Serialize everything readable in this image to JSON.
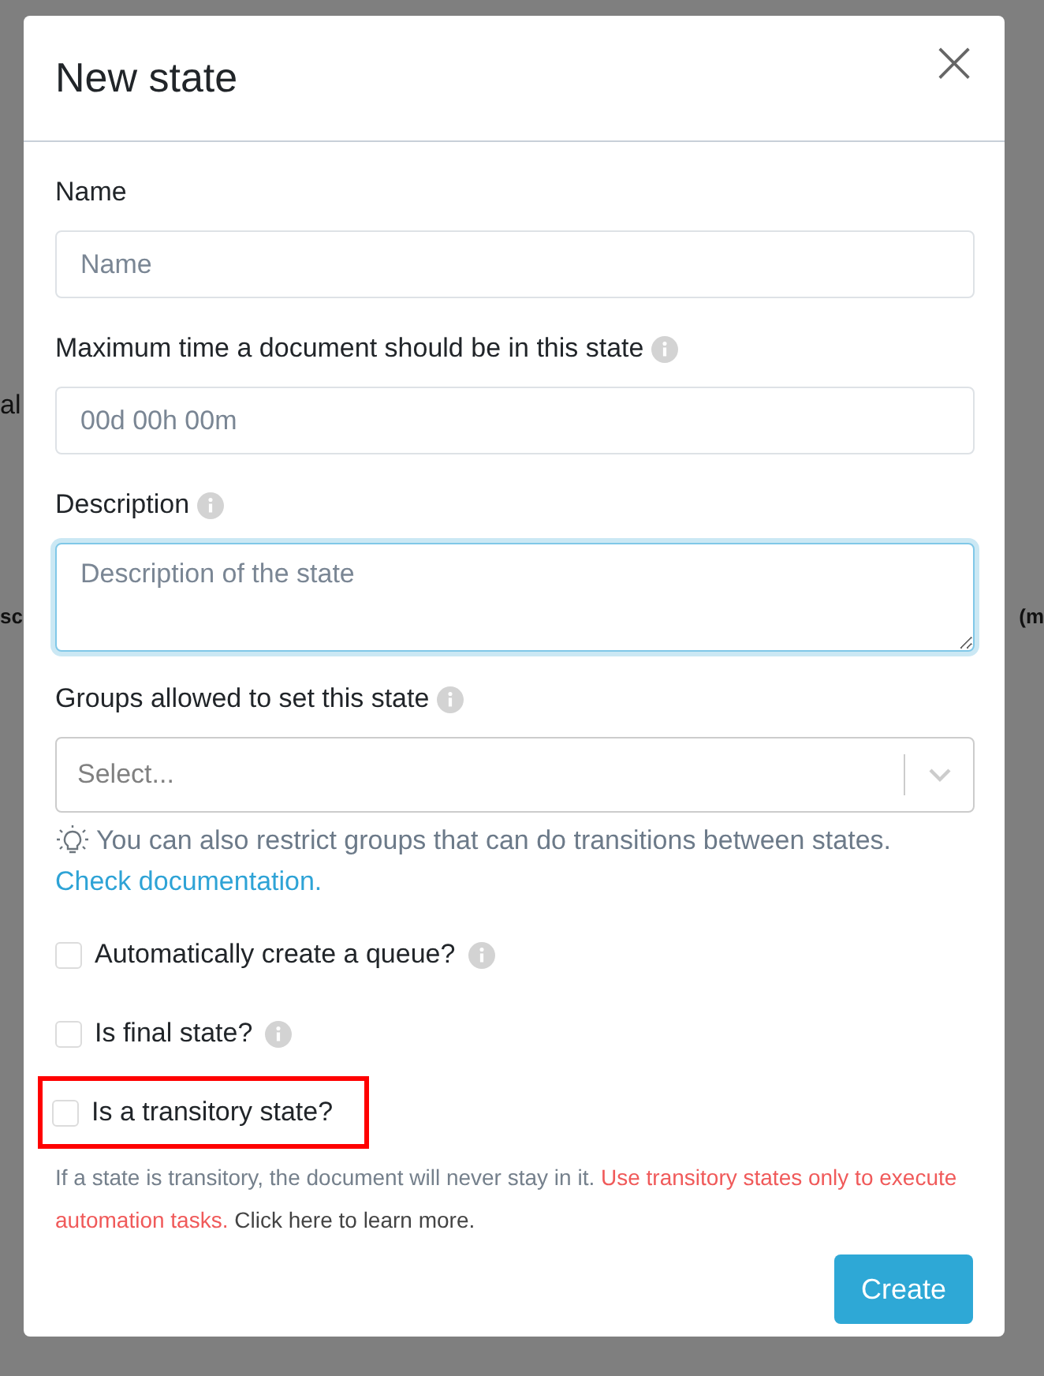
{
  "background": {
    "left_texts": [
      "al",
      "sc"
    ],
    "right_texts": [
      "(m"
    ]
  },
  "dialog": {
    "title": "New state",
    "close": "×",
    "fields": [
      {
        "kind": "input",
        "label": "Name",
        "info": false,
        "placeholder": "Name",
        "focused": false
      },
      {
        "kind": "input",
        "label": "Maximum time a document should be in this state",
        "info": true,
        "placeholder": "00d 00h 00m",
        "focused": false
      },
      {
        "kind": "textarea",
        "label": "Description",
        "info": true,
        "placeholder": "Description of the state",
        "focused": true
      },
      {
        "kind": "select",
        "label": "Groups allowed to set this state",
        "info": true,
        "placeholder": "Select...",
        "focused": false
      }
    ],
    "hint": {
      "text": "You can also restrict groups that can do transitions between states.",
      "link": "Check documentation."
    },
    "checkboxes": [
      {
        "label": "Automatically create a queue?",
        "info": true,
        "checked": false,
        "highlighted": false
      },
      {
        "label": "Is final state?",
        "info": true,
        "checked": false,
        "highlighted": false
      },
      {
        "label": "Is a transitory state?",
        "info": false,
        "checked": false,
        "highlighted": true
      }
    ],
    "note": [
      {
        "kind": "muted",
        "text": "If a state is transitory, the document will never stay in it."
      },
      {
        "kind": "warning",
        "text": "Use transitory states only to execute automation tasks."
      },
      {
        "kind": "plain",
        "text": "Click here to learn more."
      }
    ],
    "button": "Create"
  }
}
